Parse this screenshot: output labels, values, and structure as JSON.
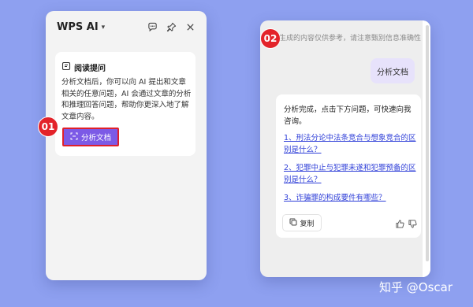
{
  "left_panel": {
    "title": "WPS AI",
    "chevron": "▾",
    "icons": [
      "chat-icon",
      "pin-icon",
      "close-icon"
    ],
    "card": {
      "title": "阅读提问",
      "text": "分析文档后，你可以向 AI 提出和文章相关的任意问题，AI 会通过文章的分析和推理回答问题，帮助你更深入地了解文章内容。",
      "button_label": "分析文档"
    },
    "badge": "01"
  },
  "right_panel": {
    "badge": "02",
    "notice": "生成的内容仅供参考，请注意甄别信息准确性",
    "user_message": "分析文档",
    "ai_message": "分析完成，点击下方问题，可快速向我咨询。",
    "questions": [
      "1、刑法分论中法条竞合与想象竞合的区别是什么？",
      "2、犯罪中止与犯罪未遂和犯罪预备的区别是什么？",
      "3、诈骗罪的构成要件有哪些？"
    ],
    "copy_label": "复制"
  },
  "watermark": "知乎 @Oscar",
  "colors": {
    "background": "#8ea0f0",
    "accent": "#7c5ae6",
    "highlight": "#e3232a",
    "link": "#2f3fd8"
  }
}
